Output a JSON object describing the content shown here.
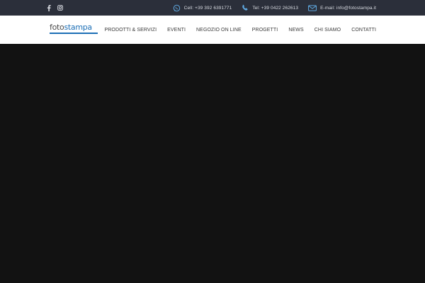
{
  "topbar": {
    "social": [
      {
        "icon": "facebook-icon",
        "glyph": "f"
      },
      {
        "icon": "instagram-icon",
        "glyph": ""
      }
    ],
    "contacts": [
      {
        "icon": "whatsapp-icon",
        "text": "Cell: +39 392 6391771"
      },
      {
        "icon": "phone-icon",
        "text": "Tel: +39 0422 262613"
      },
      {
        "icon": "envelope-icon",
        "text": "E-mail: info@fotostampa.it"
      }
    ]
  },
  "logo": {
    "part1": "foto",
    "part2": "stampa"
  },
  "menu": [
    "PRODOTTI & SERVIZI",
    "EVENTI",
    "NEGOZIO ON LINE",
    "PROGETTI",
    "NEWS",
    "CHI SIAMO",
    "CONTATTI"
  ],
  "colors": {
    "topbar_bg": "#2b2f3a",
    "accent_blue": "#1d6fb6",
    "hero_bg": "#121212",
    "icon_blue": "#5fa8e0"
  }
}
